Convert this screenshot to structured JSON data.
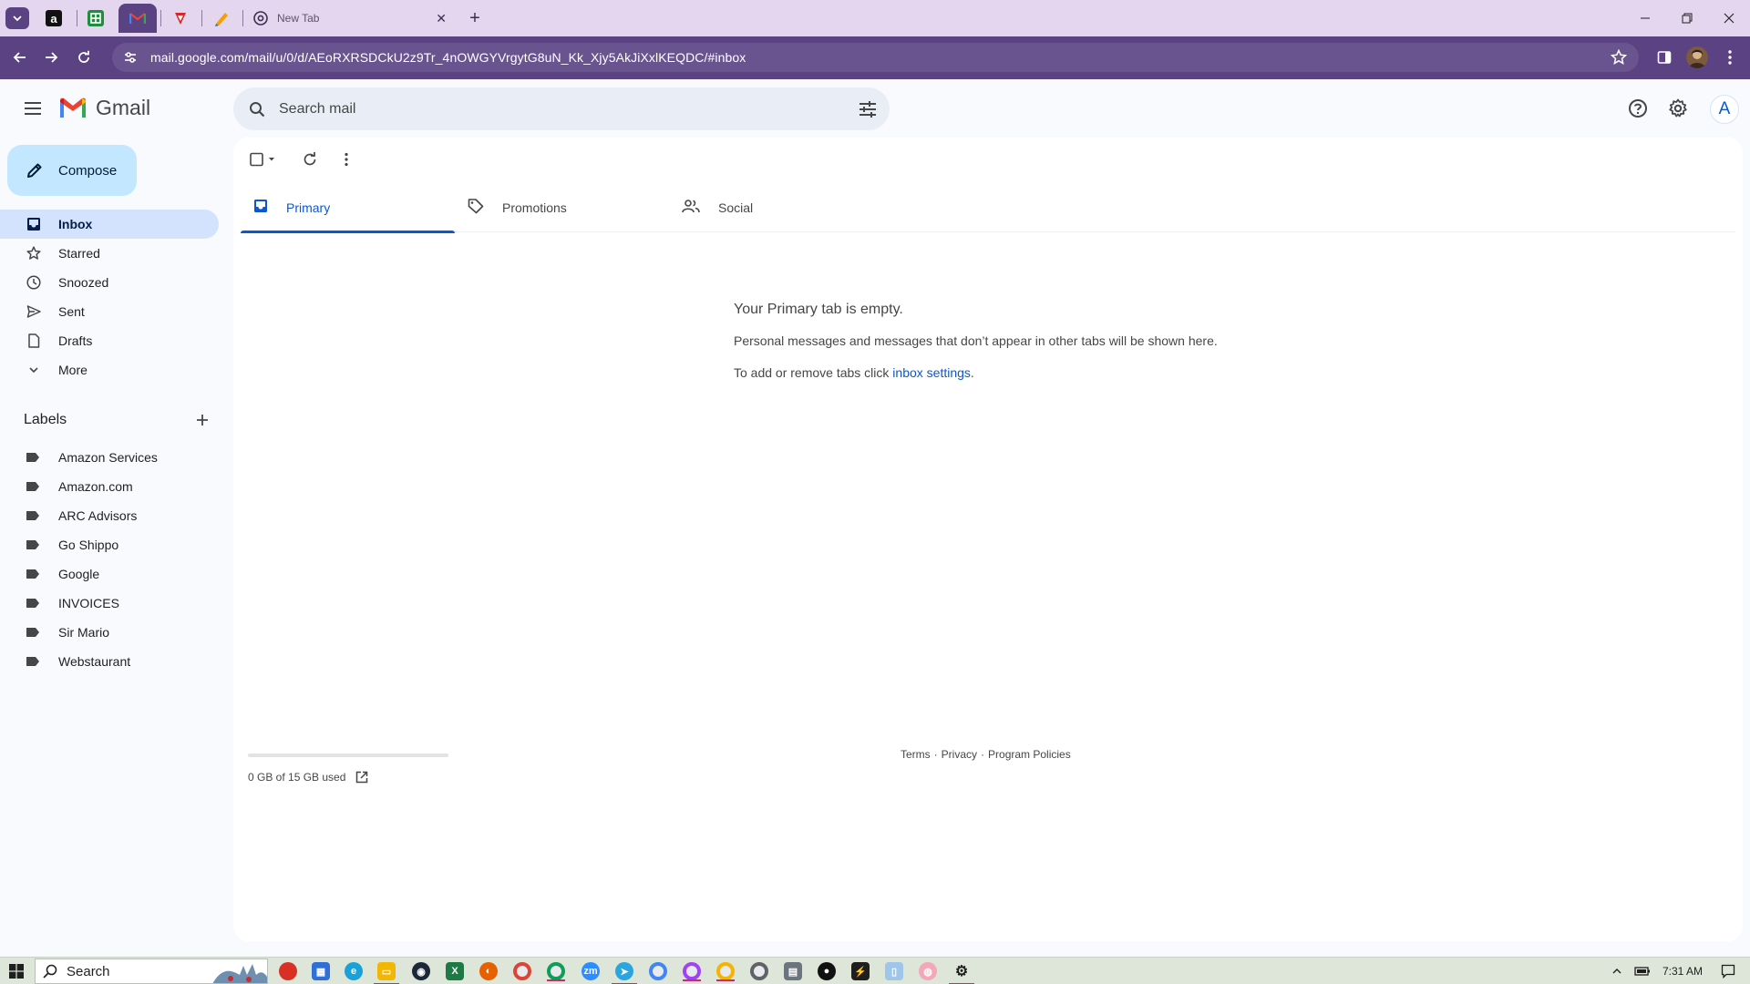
{
  "browser": {
    "tabs": {
      "new_tab_title": "New Tab"
    },
    "url": "mail.google.com/mail/u/0/d/AEoRXRSDCkU2z9Tr_4nOWGYVrgytG8uN_Kk_Xjy5AkJiXxlKEQDC/#inbox",
    "colors": {
      "frame": "#e5d6ef",
      "toolbar": "#5b4283",
      "omnibox": "#6a5490"
    }
  },
  "gmail": {
    "logo_text": "Gmail",
    "search_placeholder": "Search mail",
    "compose_label": "Compose",
    "nav": [
      {
        "label": "Inbox",
        "icon": "inbox-icon",
        "active": true
      },
      {
        "label": "Starred",
        "icon": "star-icon"
      },
      {
        "label": "Snoozed",
        "icon": "clock-icon"
      },
      {
        "label": "Sent",
        "icon": "send-icon"
      },
      {
        "label": "Drafts",
        "icon": "draft-icon"
      },
      {
        "label": "More",
        "icon": "chevron-down-icon"
      }
    ],
    "labels_title": "Labels",
    "labels": [
      "Amazon Services",
      "Amazon.com",
      "ARC Advisors",
      "Go Shippo",
      "Google",
      "INVOICES",
      "Sir Mario",
      "Webstaurant"
    ],
    "tabs": [
      {
        "label": "Primary",
        "icon": "inbox-icon",
        "active": true
      },
      {
        "label": "Promotions",
        "icon": "tag-icon"
      },
      {
        "label": "Social",
        "icon": "people-icon"
      }
    ],
    "empty": {
      "title": "Your Primary tab is empty.",
      "line1": "Personal messages and messages that don’t appear in other tabs will be shown here.",
      "line2_prefix": "To add or remove tabs click ",
      "line2_link": "inbox settings",
      "line2_suffix": "."
    },
    "storage": {
      "text": "0 GB of 15 GB used",
      "used_fraction": 0.0
    },
    "footer": {
      "terms": "Terms",
      "privacy": "Privacy",
      "policies": "Program Policies",
      "separator": "·"
    },
    "avatar_letter": "A",
    "accent": "#0b57d0"
  },
  "taskbar": {
    "search_label": "Search",
    "time": "7:31 AM"
  }
}
